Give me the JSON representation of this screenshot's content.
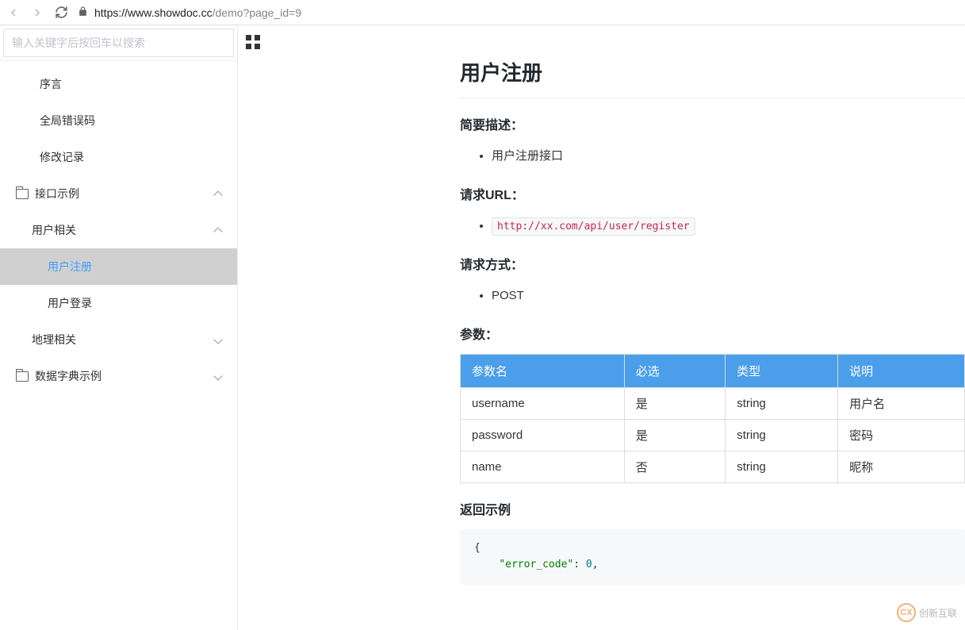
{
  "browser": {
    "url_host": "https://www.showdoc.cc",
    "url_path": "/demo?page_id=9"
  },
  "search": {
    "placeholder": "输入关键字后按回车以搜索"
  },
  "sidebar": {
    "items": [
      {
        "label": "序言"
      },
      {
        "label": "全局错误码"
      },
      {
        "label": "修改记录"
      },
      {
        "label": "接口示例"
      },
      {
        "label": "用户相关"
      },
      {
        "label": "用户注册"
      },
      {
        "label": "用户登录"
      },
      {
        "label": "地理相关"
      },
      {
        "label": "数据字典示例"
      }
    ]
  },
  "doc": {
    "title": "用户注册",
    "sections": {
      "brief_label": "简要描述：",
      "brief_item": "用户注册接口",
      "url_label": "请求URL：",
      "url_value": "http://xx.com/api/user/register",
      "method_label": "请求方式：",
      "method_value": "POST",
      "params_label": "参数：",
      "return_label": "返回示例"
    },
    "params": {
      "headers": [
        "参数名",
        "必选",
        "类型",
        "说明"
      ],
      "rows": [
        [
          "username",
          "是",
          "string",
          "用户名"
        ],
        [
          "password",
          "是",
          "string",
          "密码"
        ],
        [
          "name",
          "否",
          "string",
          "昵称"
        ]
      ]
    },
    "return_example": {
      "line1": "{",
      "line2_key": "\"error_code\"",
      "line2_val": "0"
    }
  },
  "watermark": {
    "text": "创新互联",
    "logo": "CX"
  }
}
